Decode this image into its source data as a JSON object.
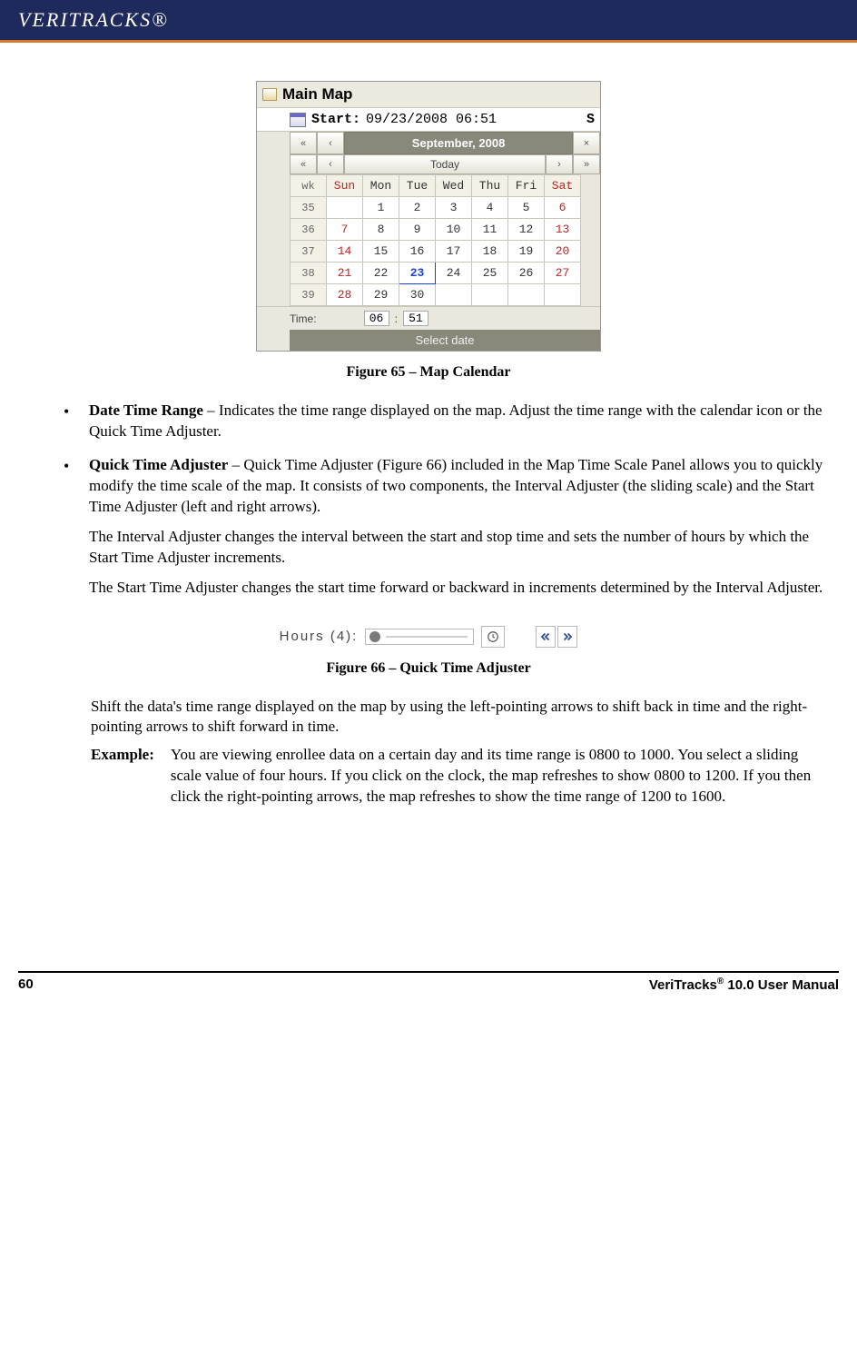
{
  "header": {
    "brand": "VERITRACKS®"
  },
  "figure65": {
    "window_title": "Main Map",
    "start_label": "Start:",
    "start_value": "09/23/2008 06:51",
    "trail": "S",
    "month_title": "September, 2008",
    "nav": {
      "first": "«",
      "prev": "‹",
      "next": "›",
      "last": "»",
      "close": "×"
    },
    "today_label": "Today",
    "headers": {
      "wk": "wk",
      "sun": "Sun",
      "mon": "Mon",
      "tue": "Tue",
      "wed": "Wed",
      "thu": "Thu",
      "fri": "Fri",
      "sat": "Sat"
    },
    "rows": [
      {
        "wk": "35",
        "sun": "",
        "mon": "1",
        "tue": "2",
        "wed": "3",
        "thu": "4",
        "fri": "5",
        "sat": "6"
      },
      {
        "wk": "36",
        "sun": "7",
        "mon": "8",
        "tue": "9",
        "wed": "10",
        "thu": "11",
        "fri": "12",
        "sat": "13"
      },
      {
        "wk": "37",
        "sun": "14",
        "mon": "15",
        "tue": "16",
        "wed": "17",
        "thu": "18",
        "fri": "19",
        "sat": "20"
      },
      {
        "wk": "38",
        "sun": "21",
        "mon": "22",
        "tue": "23",
        "wed": "24",
        "thu": "25",
        "fri": "26",
        "sat": "27"
      },
      {
        "wk": "39",
        "sun": "28",
        "mon": "29",
        "tue": "30",
        "wed": "",
        "thu": "",
        "fri": "",
        "sat": ""
      }
    ],
    "time_label": "Time:",
    "time_hour": "06",
    "time_sep": ":",
    "time_min": "51",
    "select_label": "Select date",
    "caption": "Figure 65 – Map Calendar"
  },
  "bullets": {
    "b1_term": "Date Time Range",
    "b1_text": " – Indicates the time range displayed on the map. Adjust the time range with the calendar icon or the Quick Time Adjuster.",
    "b2_term": "Quick Time Adjuster",
    "b2_text": " – Quick Time Adjuster (Figure 66) included in the Map Time Scale Panel allows you to quickly modify the time scale of the map. It consists of two components, the Interval Adjuster (the sliding scale) and the Start Time Adjuster (left and right arrows).",
    "b2_p2": "The Interval Adjuster changes the interval between the start and stop time and sets the number of hours by which the Start Time Adjuster increments.",
    "b2_p3": "The Start Time Adjuster changes the start time forward or backward in increments determined by the Interval Adjuster."
  },
  "figure66": {
    "label": "Hours (4):",
    "caption": "Figure 66 – Quick Time Adjuster"
  },
  "body_after": {
    "p1": "Shift the data's time range displayed on the map by using the left-pointing arrows to shift back in time and the right-pointing arrows to shift forward in time.",
    "ex_label": "Example:",
    "ex_text": "You are viewing enrollee data on a certain day and its time range is 0800 to 1000. You select a sliding scale value of four hours. If you click on the clock, the map refreshes to show 0800 to 1200. If you then click the right-pointing arrows, the map refreshes to show the time range of 1200 to 1600."
  },
  "footer": {
    "page": "60",
    "doc": "VeriTracks® 10.0 User Manual"
  }
}
